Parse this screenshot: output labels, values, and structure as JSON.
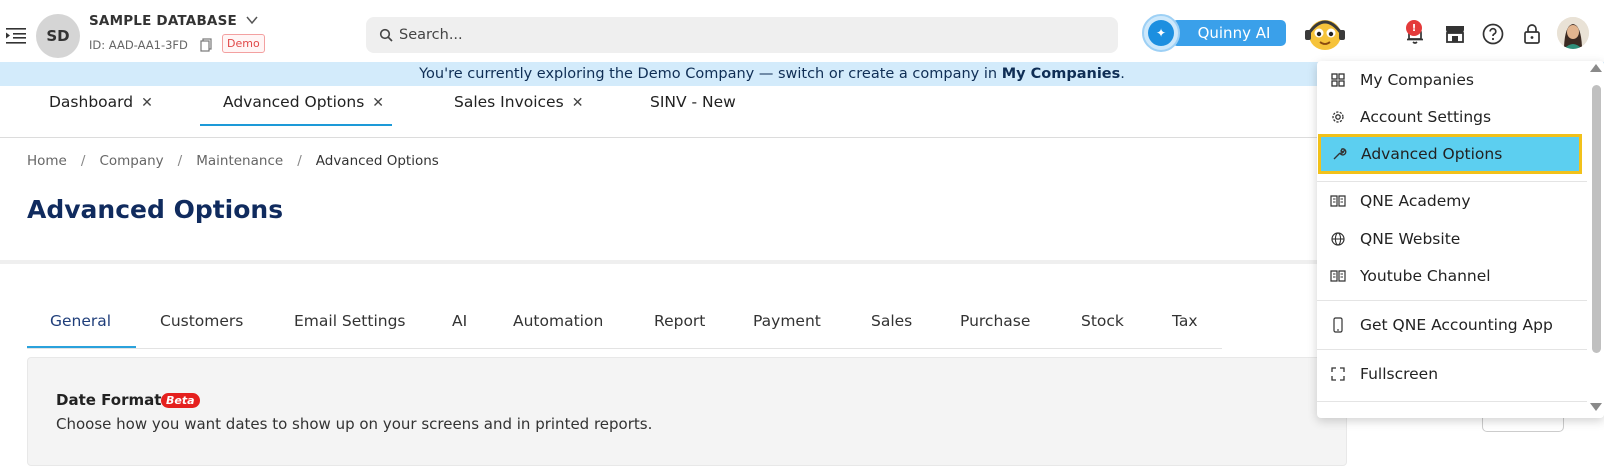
{
  "header": {
    "avatar_initials": "SD",
    "database_name": "SAMPLE DATABASE",
    "database_id": "ID: AAD-AA1-3FD",
    "demo_badge": "Demo",
    "search_placeholder": "Search...",
    "ai_button_label": "Quinny AI",
    "notification_count": "!"
  },
  "banner": {
    "text": "You're currently exploring the Demo Company — switch or create a company in ",
    "link": "My Companies",
    "suffix": "."
  },
  "doc_tabs": [
    {
      "label": "Dashboard",
      "closable": true
    },
    {
      "label": "Advanced Options",
      "closable": true,
      "active": true
    },
    {
      "label": "Sales Invoices",
      "closable": true
    },
    {
      "label": "SINV - New",
      "closable": false
    }
  ],
  "close_glyph": "✕",
  "breadcrumb": {
    "items": [
      "Home",
      "Company",
      "Maintenance",
      "Advanced Options"
    ],
    "separator": "/"
  },
  "page": {
    "title": "Advanced Options"
  },
  "settings_tabs": [
    "General",
    "Customers",
    "Email Settings",
    "AI",
    "Automation",
    "Report",
    "Payment",
    "Sales",
    "Purchase",
    "Stock",
    "Tax"
  ],
  "settings_active_tab": "General",
  "panel": {
    "title": "Date Format",
    "badge": "Beta",
    "description": "Choose how you want dates to show up on your screens and in printed reports."
  },
  "user_menu": {
    "items": [
      {
        "label": "My Companies",
        "icon": "grid-icon"
      },
      {
        "label": "Account Settings",
        "icon": "gear-icon"
      },
      {
        "label": "Advanced Options",
        "icon": "wrench-icon",
        "highlighted": true
      },
      {
        "label": "QNE Academy",
        "icon": "book-icon"
      },
      {
        "label": "QNE Website",
        "icon": "globe-icon"
      },
      {
        "label": "Youtube Channel",
        "icon": "book-icon"
      },
      {
        "label": "Get QNE Accounting App",
        "icon": "mobile-icon"
      },
      {
        "label": "Fullscreen",
        "icon": "fullscreen-icon"
      }
    ]
  },
  "colors": {
    "banner_bg": "#d3ebfb",
    "title": "#102b5e",
    "accent_underline": "#2aa2dc",
    "highlight_bg": "#5ccff0",
    "highlight_border": "#f2c11a",
    "beta_badge": "#e5201e"
  }
}
